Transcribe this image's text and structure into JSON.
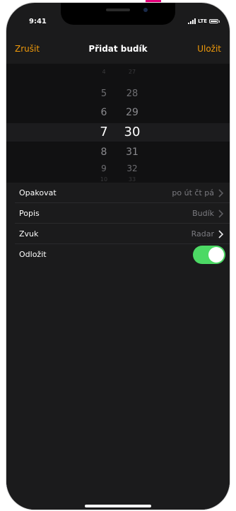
{
  "status": {
    "time": "9:41",
    "network": "LTE"
  },
  "navbar": {
    "cancel_label": "Zrušit",
    "title": "Přidat budík",
    "save_label": "Uložit"
  },
  "picker": {
    "hours": [
      "4",
      "5",
      "6",
      "7",
      "8",
      "9",
      "10"
    ],
    "minutes": [
      "27",
      "28",
      "29",
      "30",
      "31",
      "32",
      "33"
    ],
    "selected_hour": "7",
    "selected_minute": "30"
  },
  "settings": {
    "repeat": {
      "label": "Opakovat",
      "value": "po út čt pá"
    },
    "description": {
      "label": "Popis",
      "value": "Budík"
    },
    "sound": {
      "label": "Zvuk",
      "value": "Radar"
    },
    "snooze": {
      "label": "Odložit",
      "enabled": true
    }
  },
  "colors": {
    "accent": "#f09a0a",
    "toggle_on": "#4cd964",
    "background": "#1b1b1c",
    "secondary_text": "#7b7b80"
  },
  "icons": {
    "chevron": "chevron-right-icon",
    "signal": "signal-icon",
    "battery": "battery-icon"
  }
}
